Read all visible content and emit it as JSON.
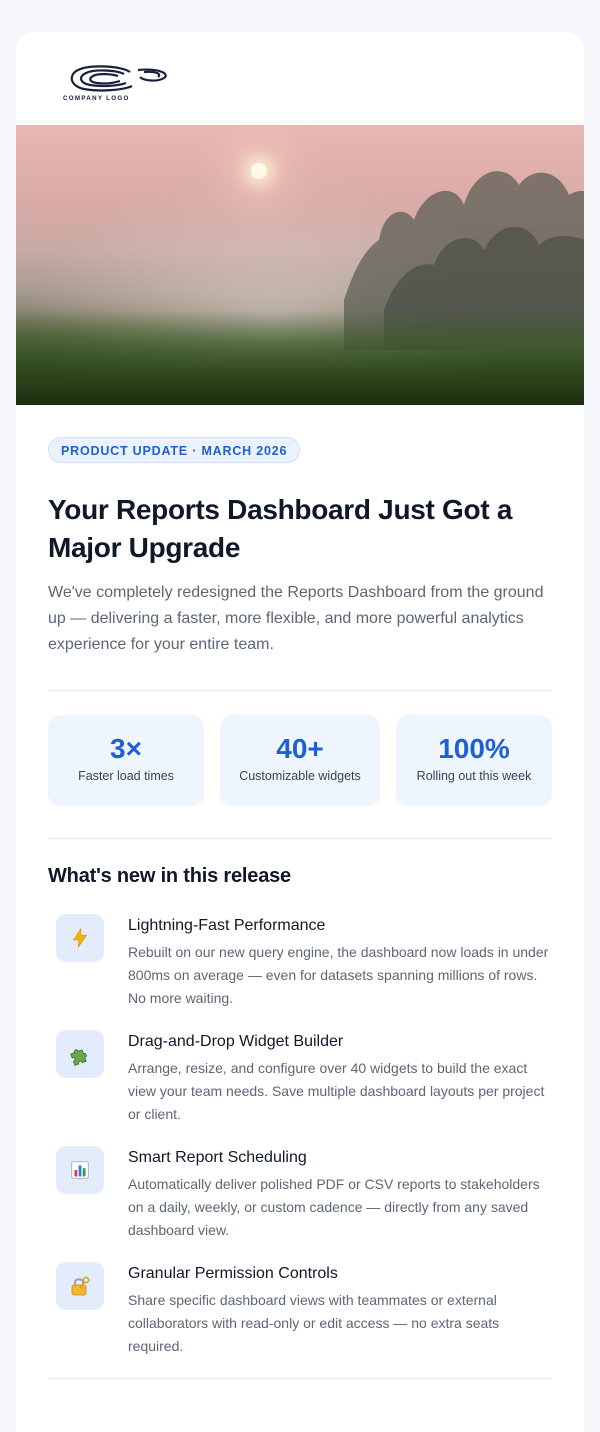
{
  "brand": {
    "logo_text": "COMPANY LOGO"
  },
  "hero": {
    "alt": "Misty pink sunrise over a grassy meadow"
  },
  "badge": "PRODUCT UPDATE · MARCH 2026",
  "title": "Your Reports Dashboard Just Got a Major Upgrade",
  "intro": "We've completely redesigned the Reports Dashboard from the ground up — delivering a faster, more flexible, and more powerful analytics experience for your entire team.",
  "stats": [
    {
      "value": "3×",
      "label": "Faster load times"
    },
    {
      "value": "40+",
      "label": "Customizable widgets"
    },
    {
      "value": "100%",
      "label": "Rolling out this week"
    }
  ],
  "section_title": "What's new in this release",
  "features": [
    {
      "icon": "lightning-icon",
      "title": "Lightning-Fast Performance",
      "desc": "Rebuilt on our new query engine, the dashboard now loads in under 800ms on average — even for datasets spanning millions of rows. No more waiting."
    },
    {
      "icon": "puzzle-icon",
      "title": "Drag-and-Drop Widget Builder",
      "desc": "Arrange, resize, and configure over 40 widgets to build the exact view your team needs. Save multiple dashboard layouts per project or client."
    },
    {
      "icon": "bar-chart-icon",
      "title": "Smart Report Scheduling",
      "desc": "Automatically deliver polished PDF or CSV reports to stakeholders on a daily, weekly, or custom cadence — directly from any saved dashboard view."
    },
    {
      "icon": "lock-key-icon",
      "title": "Granular Permission Controls",
      "desc": "Share specific dashboard views with teammates or external collaborators with read-only or edit access — no extra seats required."
    }
  ],
  "colors": {
    "accent": "#1d5fd6",
    "stat_bg": "#eef5ff",
    "icon_bg": "#e3ecfb",
    "page_bg": "#f5f7fa"
  }
}
